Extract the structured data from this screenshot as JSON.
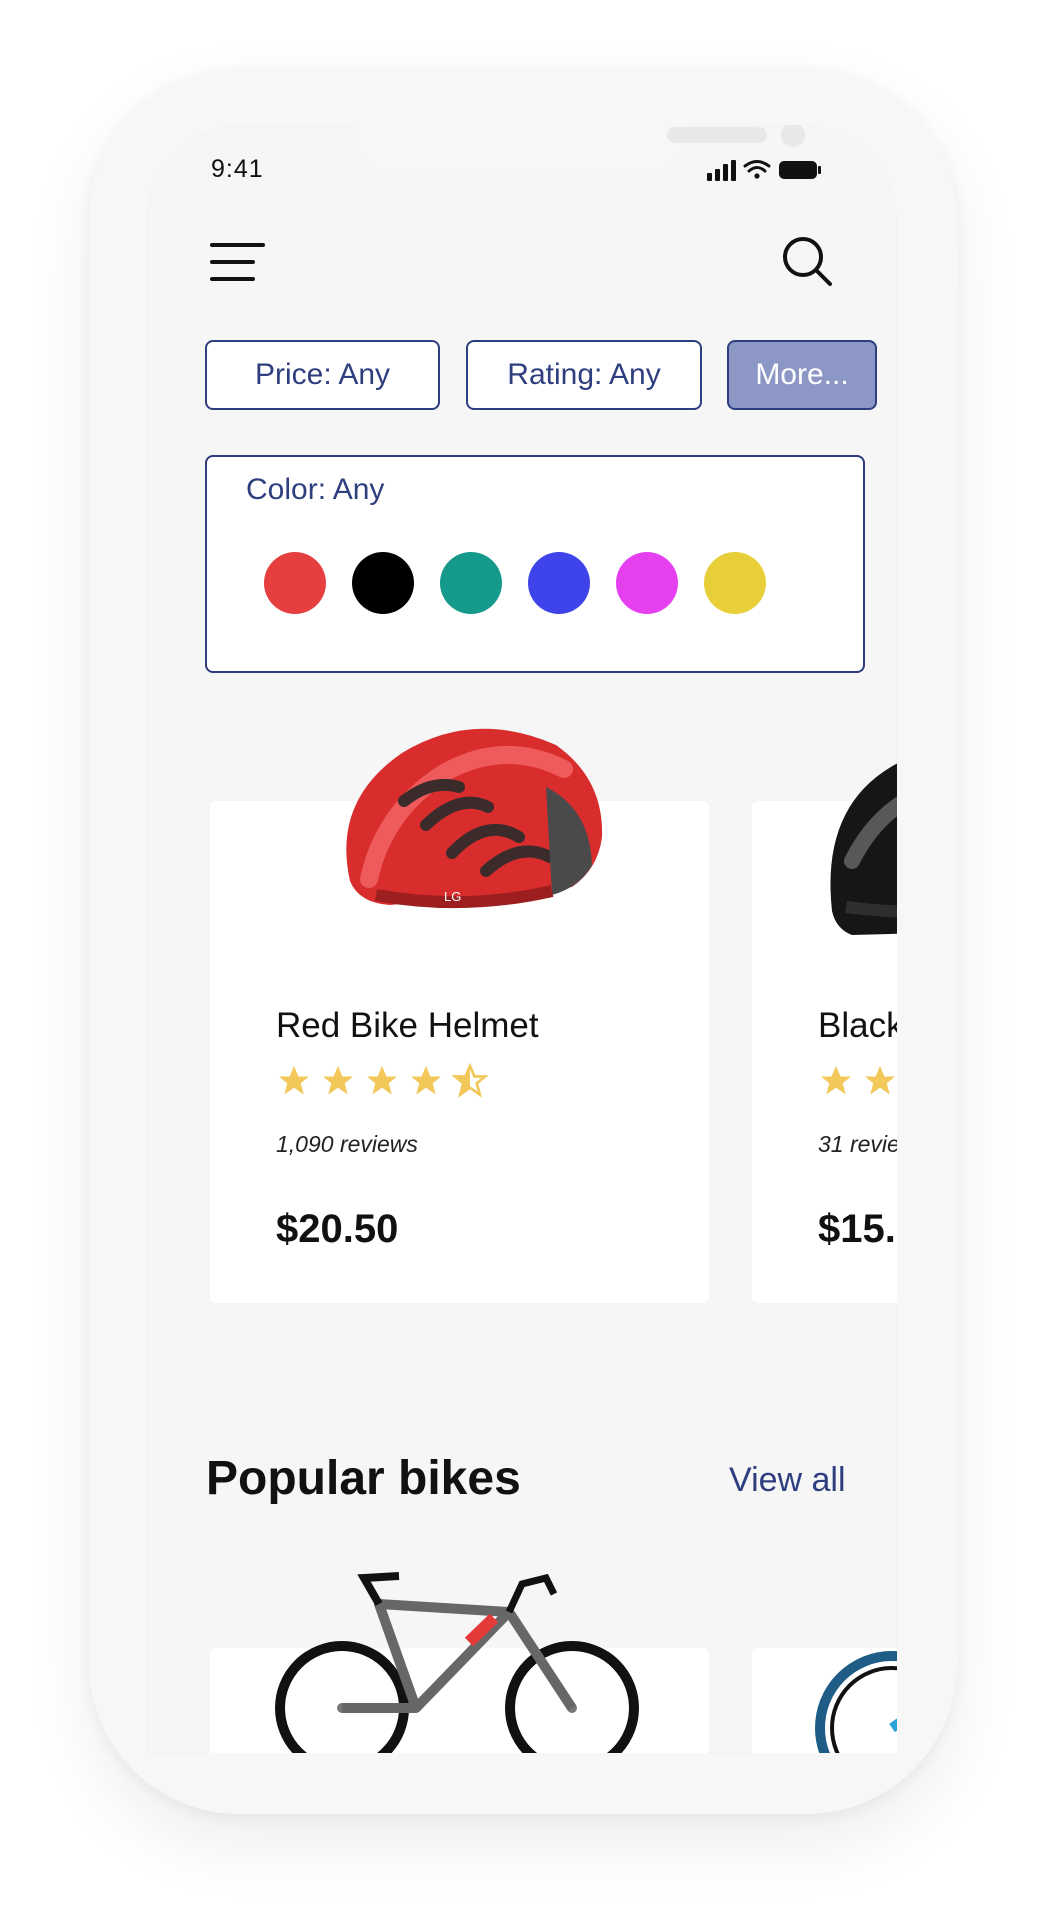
{
  "status_bar": {
    "time": "9:41",
    "icons": [
      "cellular-signal-icon",
      "wifi-icon",
      "battery-icon"
    ]
  },
  "header": {
    "menu_icon": "hamburger-menu-icon",
    "search_icon": "search-icon"
  },
  "filters": {
    "price_label": "Price: Any",
    "rating_label": "Rating: Any",
    "more_label": "More...",
    "color_label": "Color: Any",
    "colors": [
      "#e63f40",
      "#000000",
      "#14998a",
      "#3e44ea",
      "#e63ff0",
      "#e8cf3a"
    ]
  },
  "products": [
    {
      "name": "Red Bike Helmet",
      "rating": 4.5,
      "reviews": "1,090 reviews",
      "price": "$20.50",
      "image": "red-helmet-image"
    },
    {
      "name": "Black",
      "rating": 2,
      "reviews": "31 revie",
      "price": "$15.",
      "image": "black-helmet-image"
    }
  ],
  "popular": {
    "title": "Popular bikes",
    "view_all": "View all",
    "items": [
      "road-bike-image",
      "mountain-bike-image"
    ]
  },
  "colors": {
    "accent": "#2e3e7e",
    "more_button": "#8d97c6",
    "star": "#f2c85b",
    "background": "#f6f6f6"
  }
}
